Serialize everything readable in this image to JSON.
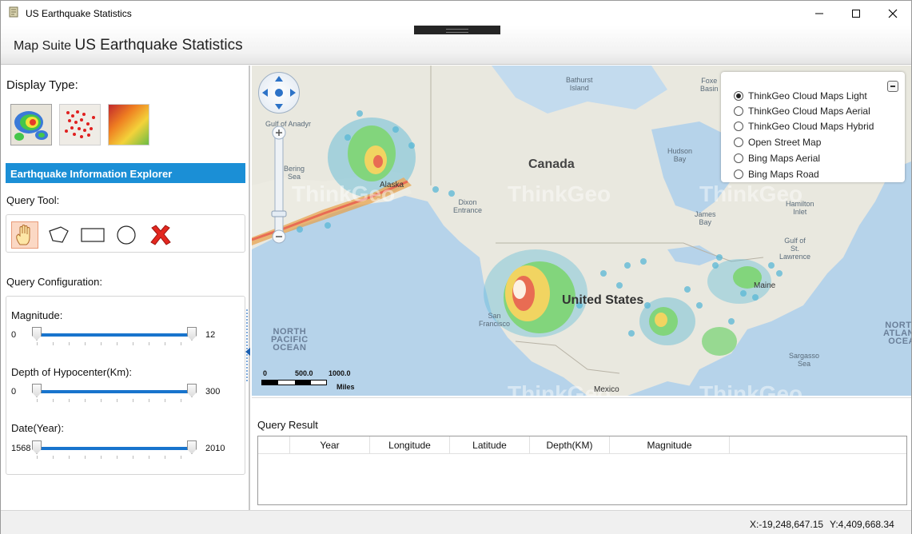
{
  "window": {
    "title": "US Earthquake Statistics",
    "controls": [
      "minimize-icon",
      "maximize-icon",
      "close-icon"
    ]
  },
  "header": {
    "prefix": "Map Suite",
    "title": "US Earthquake Statistics"
  },
  "sidebar": {
    "display_type_label": "Display Type:",
    "display_types": [
      {
        "name": "heat-map",
        "icon": "heatmap-thumb-icon"
      },
      {
        "name": "point-map",
        "icon": "pointmap-thumb-icon"
      },
      {
        "name": "isoline-map",
        "icon": "isoline-thumb-icon"
      }
    ],
    "banner": "Earthquake Information Explorer",
    "query_tool_label": "Query Tool:",
    "query_tools": [
      {
        "name": "pan",
        "icon": "hand-icon",
        "active": true
      },
      {
        "name": "polygon",
        "icon": "polygon-icon"
      },
      {
        "name": "rectangle",
        "icon": "rectangle-icon"
      },
      {
        "name": "circle",
        "icon": "circle-icon"
      },
      {
        "name": "clear",
        "icon": "red-x-icon"
      }
    ],
    "query_config_label": "Query Configuration:",
    "sliders": [
      {
        "label": "Magnitude:",
        "min": "0",
        "max": "12"
      },
      {
        "label": "Depth of Hypocenter(Km):",
        "min": "0",
        "max": "300"
      },
      {
        "label": "Date(Year):",
        "min": "1568",
        "max": "2010"
      }
    ]
  },
  "map": {
    "labels": {
      "canada": "Canada",
      "united_states": "United States",
      "north_pacific_ocean": "NORTH\nPACIFIC\nOCEAN",
      "north_atlantic_ocean": "NORTH\nATLANT\nOCEA",
      "bathurst_island": "Bathurst\nIsland",
      "foxe_basin": "Foxe\nBasin",
      "hudson_bay": "Hudson\nBay",
      "james_bay": "James\nBay",
      "bering_sea": "Bering\nSea",
      "dixon_entrance": "Dixon\nEntrance",
      "hamilton_inlet": "Hamilton\nInlet",
      "gulf_of_st_lawrence": "Gulf of\nSt.\nLawrence",
      "maine": "Maine",
      "sargasso_sea": "Sargasso\nSea",
      "mexico": "Mexico",
      "gulf_of_anadyr": "Gulf of Anadyr",
      "alaska": "Alaska",
      "san_francisco": "San\nFrancisco",
      "watermark": "ThinkGeo"
    },
    "layers": [
      {
        "label": "ThinkGeo Cloud Maps Light",
        "selected": true
      },
      {
        "label": "ThinkGeo Cloud Maps Aerial",
        "selected": false
      },
      {
        "label": "ThinkGeo Cloud Maps Hybrid",
        "selected": false
      },
      {
        "label": "Open Street Map",
        "selected": false
      },
      {
        "label": "Bing Maps Aerial",
        "selected": false
      },
      {
        "label": "Bing Maps Road",
        "selected": false
      }
    ],
    "scale": {
      "t0": "0",
      "t1": "500.0",
      "t2": "1000.0",
      "unit": "Miles"
    }
  },
  "results": {
    "title": "Query Result",
    "columns": [
      "",
      "Year",
      "Longitude",
      "Latitude",
      "Depth(KM)",
      "Magnitude",
      ""
    ]
  },
  "status": {
    "x": "X:-19,248,647.15",
    "y": "Y:4,409,668.34"
  }
}
